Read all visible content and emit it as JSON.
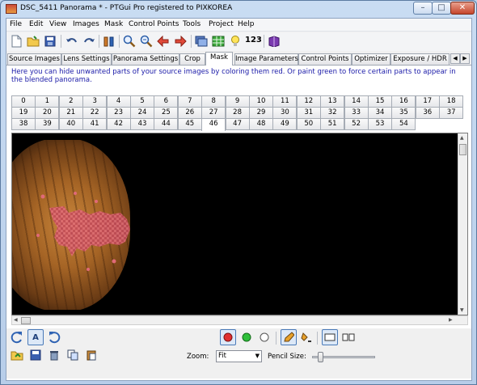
{
  "window": {
    "title": "DSC_5411 Panorama * - PTGui Pro registered to PIXKOREA",
    "min_label": "–",
    "max_label": "□",
    "close_label": "✕"
  },
  "menu": [
    "File",
    "Edit",
    "View",
    "Images",
    "Mask",
    "Control Points",
    "Tools",
    "Project",
    "Help"
  ],
  "toolbar": {
    "icons": [
      "new-project-icon",
      "open-project-icon",
      "save-icon",
      "undo-icon",
      "redo-icon",
      "settings-icon",
      "zoom-in-icon",
      "zoom-out-icon",
      "previous-icon",
      "next-icon",
      "panorama-editor-icon",
      "table-icon",
      "tips-icon",
      "numbers-label",
      "help-book-icon"
    ],
    "number_label": "123"
  },
  "tabs": [
    "Source Images",
    "Lens Settings",
    "Panorama Settings",
    "Crop",
    "Mask",
    "Image Parameters",
    "Control Points",
    "Optimizer",
    "Exposure / HDR"
  ],
  "active_tab": "Mask",
  "help_text": "Here you can hide unwanted parts of your source images by coloring them red. Or paint green to force certain parts to appear in the blended panorama.",
  "image_tabs": {
    "row1": [
      "0",
      "1",
      "2",
      "3",
      "4",
      "5",
      "6",
      "7",
      "8",
      "9",
      "10",
      "11",
      "12",
      "13",
      "14",
      "15",
      "16",
      "17",
      "18"
    ],
    "row2": [
      "19",
      "20",
      "21",
      "22",
      "23",
      "24",
      "25",
      "26",
      "27",
      "28",
      "29",
      "30",
      "31",
      "32",
      "33",
      "34",
      "35",
      "36",
      "37"
    ],
    "row3": [
      "38",
      "39",
      "40",
      "41",
      "42",
      "43",
      "44",
      "45",
      "46",
      "47",
      "48",
      "49",
      "50",
      "51",
      "52",
      "53",
      "54"
    ],
    "active": "46"
  },
  "bottom": {
    "zoom_label": "Zoom:",
    "zoom_value": "Fit",
    "pencil_label": "Pencil Size:",
    "pencil_size": 0.1,
    "colors": {
      "red": "#e03030",
      "green": "#2fbf3a",
      "clear": "#ffffff"
    }
  }
}
